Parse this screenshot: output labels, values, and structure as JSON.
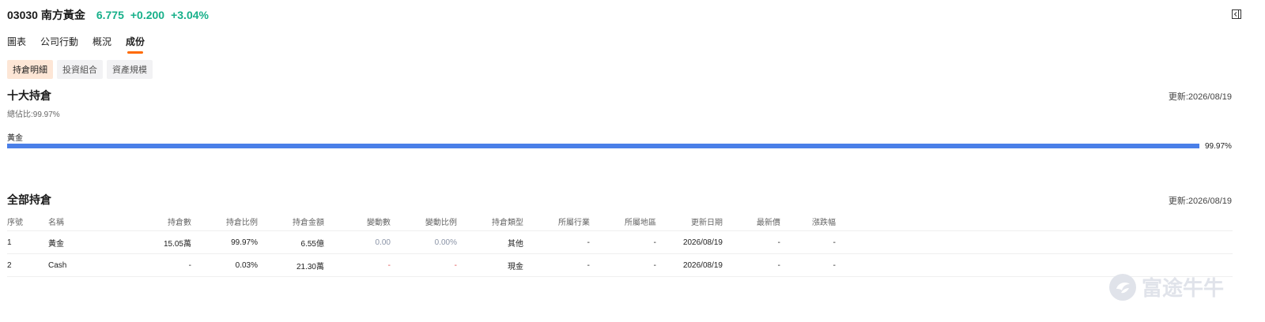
{
  "header": {
    "code_name": "03030 南方黃金",
    "price": "6.775",
    "change": "+0.200",
    "change_pct": "+3.04%",
    "up_color": "#17b08a"
  },
  "tabs": [
    "圖表",
    "公司行動",
    "概況",
    "成份"
  ],
  "active_tab": "成份",
  "subtabs": [
    "持倉明細",
    "投資組合",
    "資產規模"
  ],
  "active_subtab": "持倉明細",
  "top_holdings": {
    "title": "十大持倉",
    "updated": "更新:2026/08/19",
    "total_ratio": "總佔比:99.97%",
    "bars": [
      {
        "label": "黃金",
        "value": "99.97%",
        "percent": 99.97,
        "color": "#4a7fe8"
      }
    ]
  },
  "all_holdings": {
    "title": "全部持倉",
    "updated": "更新:2026/08/19",
    "columns": [
      "序號",
      "名稱",
      "持倉數",
      "持倉比例",
      "持倉金額",
      "變動數",
      "變動比例",
      "持倉類型",
      "所屬行業",
      "所屬地區",
      "更新日期",
      "最新價",
      "漲跌幅"
    ],
    "rows": [
      [
        "1",
        "黃金",
        "15.05萬",
        "99.97%",
        "6.55億",
        "0.00",
        "0.00%",
        "其他",
        "-",
        "-",
        "2026/08/19",
        "-",
        "-"
      ],
      [
        "2",
        "Cash",
        "-",
        "0.03%",
        "21.30萬",
        "-",
        "-",
        "現金",
        "-",
        "-",
        "2026/08/19",
        "-",
        "-"
      ]
    ]
  },
  "watermark": {
    "text": "富途牛牛"
  }
}
